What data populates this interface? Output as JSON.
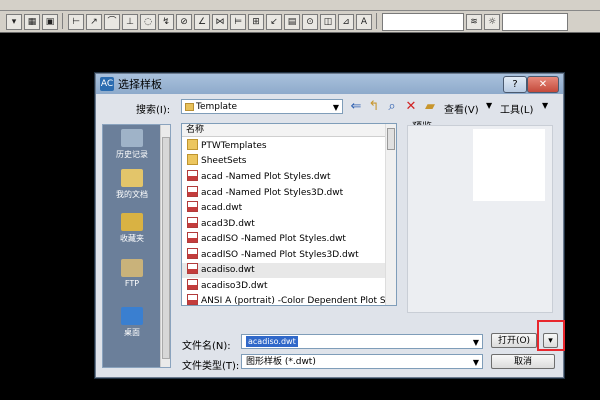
{
  "dialog": {
    "title": "选择样板",
    "title_icon": "AC",
    "help_label": "?",
    "close_label": "✕",
    "search_label": "搜索(I):",
    "search_folder": "Template",
    "view_menu": "查看(V)",
    "tools_menu": "工具(L)",
    "preview_label": "预览",
    "places": [
      {
        "label": "历史记录",
        "icon": "history-icon",
        "color": "#9fb3c8"
      },
      {
        "label": "我的文档",
        "icon": "my-documents-icon",
        "color": "#e3c56a"
      },
      {
        "label": "收藏夹",
        "icon": "favorites-icon",
        "color": "#d9b243"
      },
      {
        "label": "FTP",
        "icon": "ftp-icon",
        "color": "#c9b27a"
      },
      {
        "label": "桌面",
        "icon": "desktop-icon",
        "color": "#3a7fd0"
      }
    ],
    "list_header": "名称",
    "files": [
      {
        "name": "PTWTemplates",
        "type": "folder"
      },
      {
        "name": "SheetSets",
        "type": "folder"
      },
      {
        "name": "acad -Named Plot Styles.dwt",
        "type": "dwt"
      },
      {
        "name": "acad -Named Plot Styles3D.dwt",
        "type": "dwt"
      },
      {
        "name": "acad.dwt",
        "type": "dwt"
      },
      {
        "name": "acad3D.dwt",
        "type": "dwt"
      },
      {
        "name": "acadISO -Named Plot Styles.dwt",
        "type": "dwt"
      },
      {
        "name": "acadISO -Named Plot Styles3D.dwt",
        "type": "dwt"
      },
      {
        "name": "acadiso.dwt",
        "type": "dwt",
        "selected": true
      },
      {
        "name": "acadiso3D.dwt",
        "type": "dwt"
      },
      {
        "name": "ANSI A (portrait) -Color Dependent Plot Style",
        "type": "dwt"
      }
    ],
    "filename_label": "文件名(N):",
    "filename_value": "acadiso.dwt",
    "filetype_label": "文件类型(T):",
    "filetype_value": "图形样板 (*.dwt)",
    "open_label": "打开(O)",
    "open_dropdown": "▾",
    "cancel_label": "取消"
  },
  "colors": {
    "highlight": "#e8262d",
    "selection": "#3068c9"
  }
}
